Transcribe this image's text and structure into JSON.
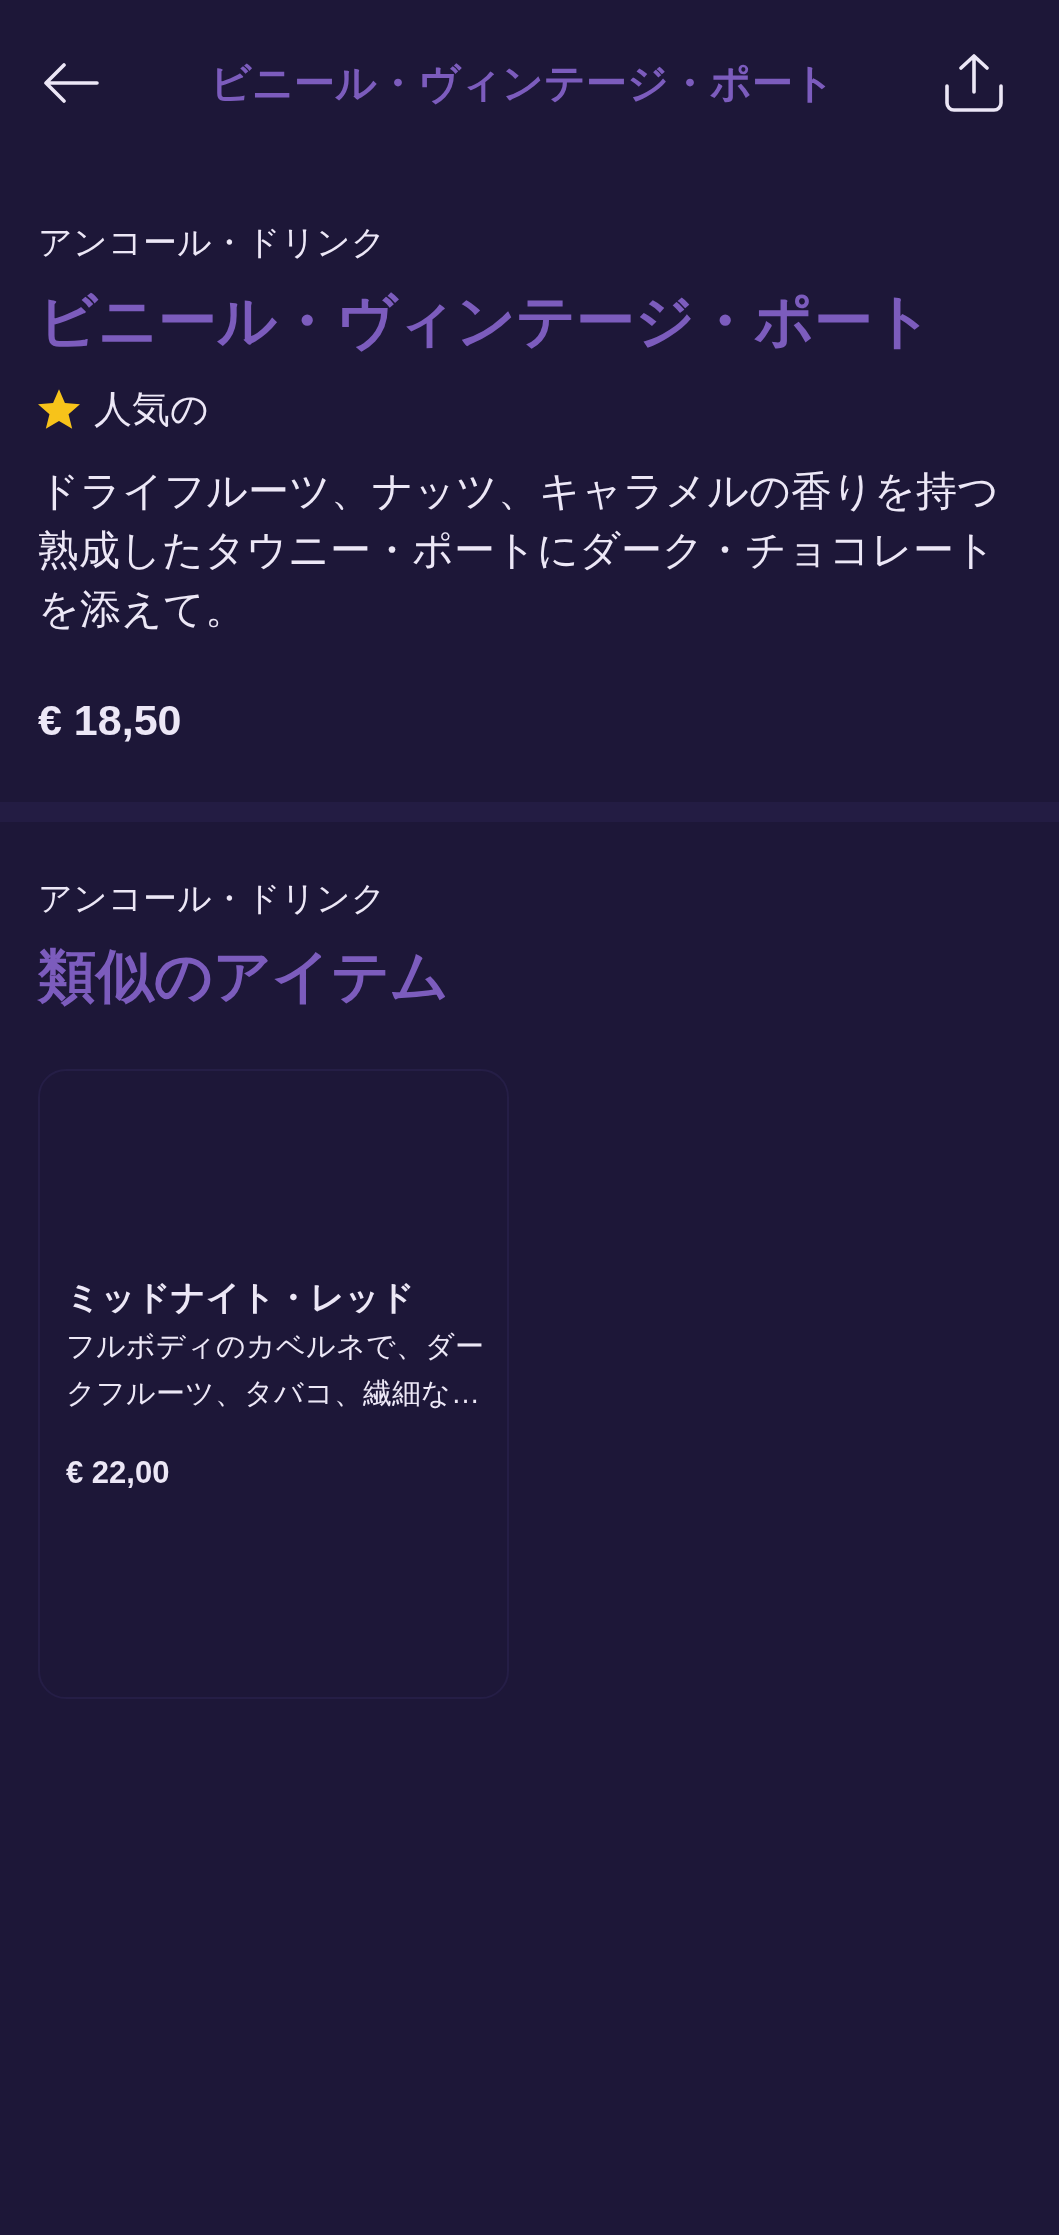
{
  "header": {
    "title": "ビニール・ヴィンテージ・ポート"
  },
  "product": {
    "category": "アンコール・ドリンク",
    "name": "ビニール・ヴィンテージ・ポート",
    "badge": {
      "label": "人気の"
    },
    "description": "ドライフルーツ、ナッツ、キャラメルの香りを持つ熟成したタウニー・ポートにダーク・チョコレートを添えて。",
    "price": "€ 18,50"
  },
  "similar": {
    "category": "アンコール・ドリンク",
    "heading": "類似のアイテム",
    "items": [
      {
        "name": "ミッドナイト・レッド",
        "description": "フルボディのカベルネで、ダークフルーツ、タバコ、繊細な…",
        "price": "€ 22,00"
      }
    ]
  }
}
